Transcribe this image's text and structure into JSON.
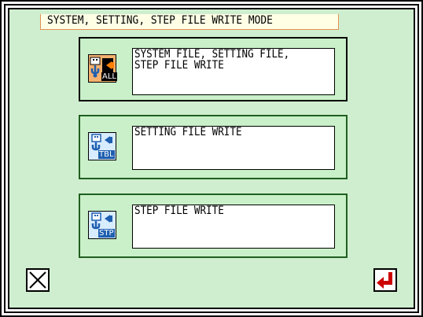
{
  "header": {
    "title": "SYSTEM, SETTING, STEP FILE WRITE MODE"
  },
  "options": [
    {
      "label": "SYSTEM FILE, SETTING FILE,\nSTEP FILE WRITE",
      "icon": "usb-write-all-icon",
      "badge": "ALL"
    },
    {
      "label": "SETTING FILE WRITE",
      "icon": "usb-write-table-icon",
      "badge": "TBL"
    },
    {
      "label": "STEP FILE WRITE",
      "icon": "usb-write-step-icon",
      "badge": "STP"
    }
  ],
  "footer": {
    "cancel_icon": "close-icon",
    "enter_icon": "enter-arrow-icon"
  },
  "colors": {
    "screen": "#cfeecf",
    "panel": "#c9f0c9",
    "accent_red": "#cc0000",
    "icon_blue": "#1e5fb0",
    "orange": "#f4b16f"
  }
}
